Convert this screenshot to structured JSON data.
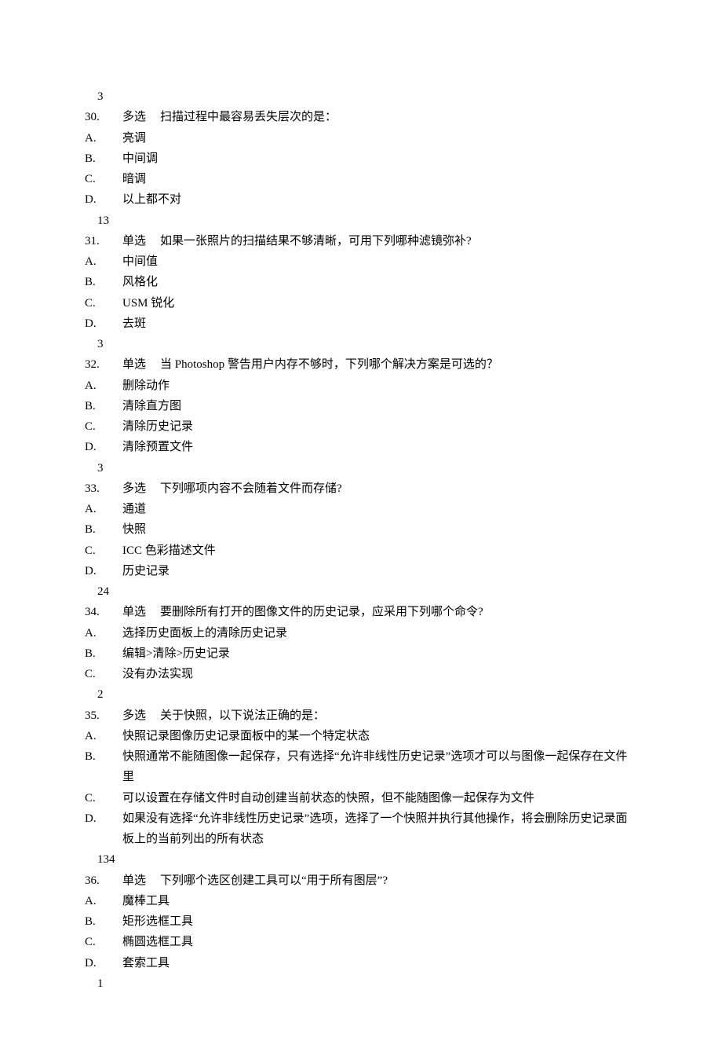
{
  "pre_answer": "3",
  "questions": [
    {
      "num": "30.",
      "type": "多选",
      "stem": "扫描过程中最容易丢失层次的是：",
      "options": [
        {
          "label": "A.",
          "text": "亮调"
        },
        {
          "label": "B.",
          "text": "中间调"
        },
        {
          "label": "C.",
          "text": "暗调"
        },
        {
          "label": "D.",
          "text": "以上都不对"
        }
      ],
      "answer": "13"
    },
    {
      "num": "31.",
      "type": "单选",
      "stem": "如果一张照片的扫描结果不够清晰，可用下列哪种滤镜弥补?",
      "options": [
        {
          "label": "A.",
          "text": "中间值"
        },
        {
          "label": "B.",
          "text": "风格化"
        },
        {
          "label": "C.",
          "text": "USM 锐化"
        },
        {
          "label": "D.",
          "text": "去斑"
        }
      ],
      "answer": "3"
    },
    {
      "num": "32.",
      "type": "单选",
      "stem": "当 Photoshop 警告用户内存不够时，下列哪个解决方案是可选的？",
      "options": [
        {
          "label": "A.",
          "text": "删除动作"
        },
        {
          "label": "B.",
          "text": "清除直方图"
        },
        {
          "label": "C.",
          "text": "清除历史记录"
        },
        {
          "label": "D.",
          "text": "清除预置文件"
        }
      ],
      "answer": "3"
    },
    {
      "num": "33.",
      "type": "多选",
      "stem": "下列哪项内容不会随着文件而存储?",
      "options": [
        {
          "label": "A.",
          "text": "通道"
        },
        {
          "label": "B.",
          "text": "快照"
        },
        {
          "label": "C.",
          "text": "ICC 色彩描述文件"
        },
        {
          "label": "D.",
          "text": "历史记录"
        }
      ],
      "answer": "24"
    },
    {
      "num": "34.",
      "type": "单选",
      "stem": "要删除所有打开的图像文件的历史记录，应采用下列哪个命令?",
      "options": [
        {
          "label": "A.",
          "text": "选择历史面板上的清除历史记录"
        },
        {
          "label": "B.",
          "text": "编辑>清除>历史记录"
        },
        {
          "label": "C.",
          "text": "没有办法实现"
        }
      ],
      "answer": "2"
    },
    {
      "num": "35.",
      "type": "多选",
      "stem": "关于快照，以下说法正确的是：",
      "options": [
        {
          "label": "A.",
          "text": "快照记录图像历史记录面板中的某一个特定状态"
        },
        {
          "label": "B.",
          "text": "快照通常不能随图像一起保存，只有选择“允许非线性历史记录”选项才可以与图像一起保存在文件里"
        },
        {
          "label": "C.",
          "text": "可以设置在存储文件时自动创建当前状态的快照，但不能随图像一起保存为文件"
        },
        {
          "label": "D.",
          "text": "如果没有选择“允许非线性历史记录”选项，选择了一个快照并执行其他操作，将会删除历史记录面板上的当前列出的所有状态"
        }
      ],
      "answer": "134"
    },
    {
      "num": "36.",
      "type": "单选",
      "stem": "下列哪个选区创建工具可以“用于所有图层”?",
      "options": [
        {
          "label": "A.",
          "text": "魔棒工具"
        },
        {
          "label": "B.",
          "text": "矩形选框工具"
        },
        {
          "label": "C.",
          "text": "椭圆选框工具"
        },
        {
          "label": "D.",
          "text": "套索工具"
        }
      ],
      "answer": "1"
    }
  ]
}
